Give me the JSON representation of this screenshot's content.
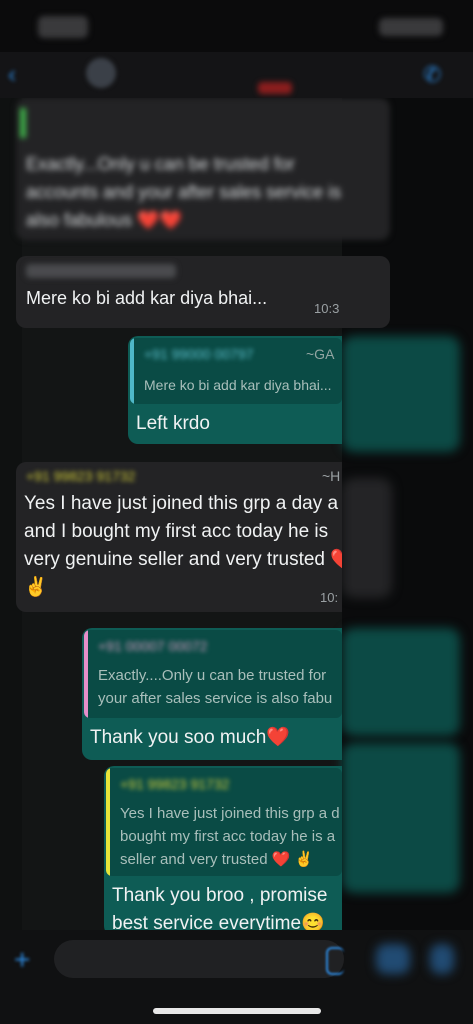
{
  "status_bar": {
    "time": "",
    "icons": ""
  },
  "header": {
    "back_icon": "chevron-left-icon",
    "title": "",
    "call_icon": "phone-icon"
  },
  "messages": {
    "m1": {
      "quoted_text": "",
      "text_line1": "Exactly...Only u can be trusted for",
      "text_line2": "accounts and your after sales service is",
      "text_line3": "also fabulous ❤️❤️"
    },
    "m2": {
      "text": "Mere ko bi add kar diya bhai...",
      "time": "10:3"
    },
    "m3": {
      "quote_sender": "+91 99000 00797",
      "quote_sender_name": "~GA",
      "quote_text": "Mere ko bi add kar diya bhai...",
      "text": "Left krdo"
    },
    "m4": {
      "sender": "+91 99823 91732",
      "sender_name": "~H",
      "line1": "Yes I have just joined this grp a day a",
      "line2": "and I bought my first acc today he is",
      "line3": "very genuine seller and very trusted ❤️",
      "line4": "✌️",
      "time": "10:"
    },
    "m5": {
      "quote_sender": "+91 00007 00072",
      "quote_line1": "Exactly....Only u can be trusted for",
      "quote_line2": "your after sales service is also fabu",
      "text": "Thank you soo much❤️"
    },
    "m6": {
      "quote_sender": "+91 99823 91732",
      "quote_line1": "Yes I have just joined this grp a d",
      "quote_line2": "bought my first acc today he is a",
      "quote_line3": "seller and very trusted ❤️ ✌️",
      "text_line1": "Thank you broo , promise",
      "text_line2": "best service everytime😊"
    }
  },
  "composer": {
    "plus_icon": "plus-icon",
    "input_value": "",
    "sticker_icon": "sticker-icon",
    "camera_icon": "camera-icon",
    "mic_icon": "mic-icon"
  },
  "colors": {
    "accent": "#2d8ae0",
    "outgoing_bubble": "#0e5c55",
    "incoming_bubble": "#232325",
    "quote_bar_teal": "#4fb8c8",
    "quote_bar_pink": "#e58ec9",
    "quote_bar_yellow": "#e7e43a",
    "sender_yellow": "#d6d23a"
  }
}
